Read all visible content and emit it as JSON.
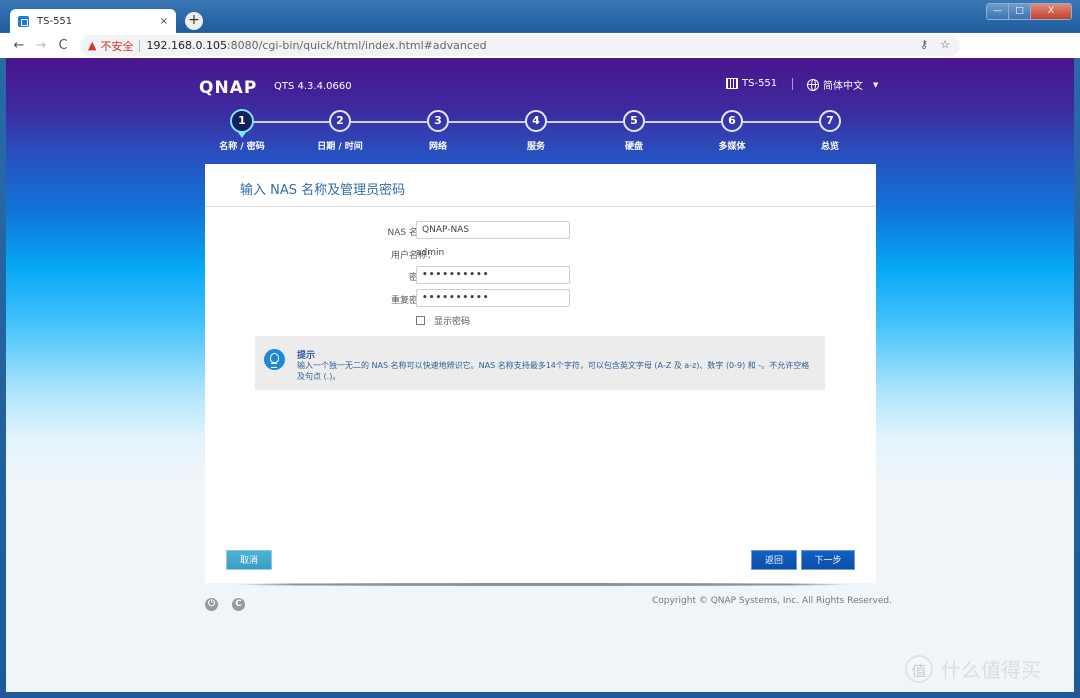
{
  "browser": {
    "tab_title": "TS-551",
    "tab_close": "×",
    "new_tab": "+",
    "nav": {
      "back": "←",
      "forward": "→",
      "reload": "C"
    },
    "security_warning": "不安全",
    "url_host": "192.168.0.105",
    "url_rest": ":8080/cgi-bin/quick/html/index.html#advanced",
    "omnibox_icons": {
      "key": "⚷",
      "star": "☆"
    },
    "window_controls": {
      "minimize": "—",
      "maximize": "□",
      "close": "X"
    }
  },
  "header": {
    "brand": "QNAP",
    "version": "QTS 4.3.4.0660",
    "device": "TS-551",
    "language": "简体中文",
    "caret": "▼"
  },
  "stepper": {
    "active_step": 1,
    "steps": [
      {
        "num": "1",
        "label": "名称 / 密码"
      },
      {
        "num": "2",
        "label": "日期 / 时间"
      },
      {
        "num": "3",
        "label": "网络"
      },
      {
        "num": "4",
        "label": "服务"
      },
      {
        "num": "5",
        "label": "硬盘"
      },
      {
        "num": "6",
        "label": "多媒体"
      },
      {
        "num": "7",
        "label": "总览"
      }
    ]
  },
  "form": {
    "title": "输入 NAS 名称及管理员密码",
    "nas_name_label": "NAS 名称：",
    "nas_name_value": "QNAP-NAS",
    "username_label": "用户名称：",
    "username_value": "admin",
    "password_label": "密码：",
    "password_value": "••••••••••",
    "confirm_label": "重复密码：",
    "confirm_value": "••••••••••",
    "show_password_label": "显示密码",
    "show_password_checked": false
  },
  "hint": {
    "title": "提示",
    "text": "输入一个独一无二的 NAS 名称可以快速地辨识它。NAS 名称支持最多14个字符，可以包含英文字母 (A-Z 及 a-z)、数字 (0-9) 和 -。不允许空格及句点 (.)。"
  },
  "buttons": {
    "cancel": "取消",
    "back": "返回",
    "next": "下一步"
  },
  "footer": {
    "copyright": "Copyright © QNAP Systems, Inc. All Rights Reserved.",
    "power_icon": "⏻",
    "restart_icon": "C"
  },
  "watermark": {
    "badge": "值",
    "text": "什么值得买"
  }
}
